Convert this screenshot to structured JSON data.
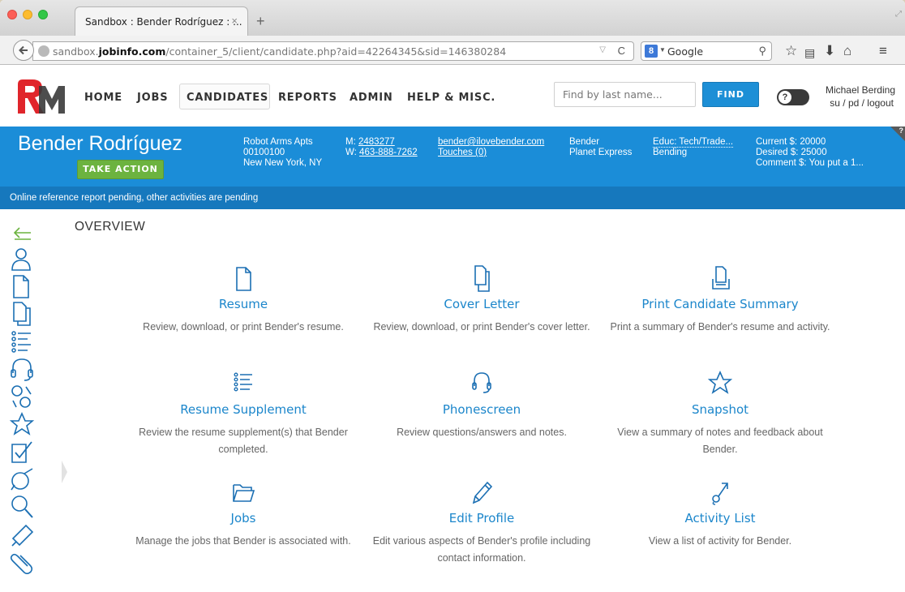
{
  "browser": {
    "tab_title": "Sandbox : Bender Rodríguez : ...",
    "tab_close": "×",
    "new_tab": "+",
    "url_prefix": "sandbox.",
    "url_domain": "jobinfo.com",
    "url_path": "/container_5/client/candidate.php?aid=42264345&sid=146380284",
    "search_engine": "Google",
    "search_engine_letter": "8"
  },
  "header": {
    "nav": [
      "HOME",
      "JOBS",
      "CANDIDATES",
      "REPORTS",
      "ADMIN",
      "HELP & MISC."
    ],
    "active_nav": "CANDIDATES",
    "find_placeholder": "Find by last name...",
    "find_button": "FIND",
    "help_toggle": "?",
    "user_name": "Michael Berding",
    "user_links": "su / pd / logout"
  },
  "candidate": {
    "name": "Bender Rodríguez",
    "take_action": "TAKE ACTION",
    "address": [
      "Robot Arms Apts",
      "00100100",
      "New New York, NY"
    ],
    "mobile_label": "M:",
    "mobile": "2483277",
    "work_label": "W:",
    "work": "463-888-7262",
    "email": "bender@ilovebender.com",
    "touches": "Touches (0)",
    "company": [
      "Bender",
      "Planet Express"
    ],
    "educ": "Educ: Tech/Trade...",
    "field": "Bending",
    "current_pay": "Current $: 20000",
    "desired_pay": "Desired $: 25000",
    "comment_pay": "Comment $: You put a 1...",
    "corner_help": "?",
    "pending_message": "Online reference report pending, other activities are pending"
  },
  "overview_heading": "OVERVIEW",
  "cards": [
    {
      "title": "Resume",
      "desc": "Review, download, or print Bender's resume."
    },
    {
      "title": "Cover Letter",
      "desc": "Review, download, or print Bender's cover letter."
    },
    {
      "title": "Print Candidate Summary",
      "desc": "Print a summary of Bender's resume and activity."
    },
    {
      "title": "Resume Supplement",
      "desc": "Review the resume supplement(s) that Bender completed."
    },
    {
      "title": "Phonescreen",
      "desc": "Review questions/answers and notes."
    },
    {
      "title": "Snapshot",
      "desc": "View a summary of notes and feedback about Bender."
    },
    {
      "title": "Jobs",
      "desc": "Manage the jobs that Bender is associated with."
    },
    {
      "title": "Edit Profile",
      "desc": "Edit various aspects of Bender's profile including contact information."
    },
    {
      "title": "Activity List",
      "desc": "View a list of activity for Bender."
    }
  ],
  "rail_icons": [
    "collapse-arrow-icon",
    "person-icon",
    "resume-icon",
    "cover-letter-icon",
    "supplement-list-icon",
    "phonescreen-icon",
    "reference-icon",
    "snapshot-star-icon",
    "checklist-icon",
    "tag-icon",
    "search-icon",
    "megaphone-icon",
    "paperclip-icon"
  ],
  "colors": {
    "brand_blue": "#1b8dd8",
    "pending_bar": "#1678bd",
    "take_action_green": "#6cb33f",
    "link_blue": "#1b86cb",
    "logo_red": "#e0252b"
  }
}
